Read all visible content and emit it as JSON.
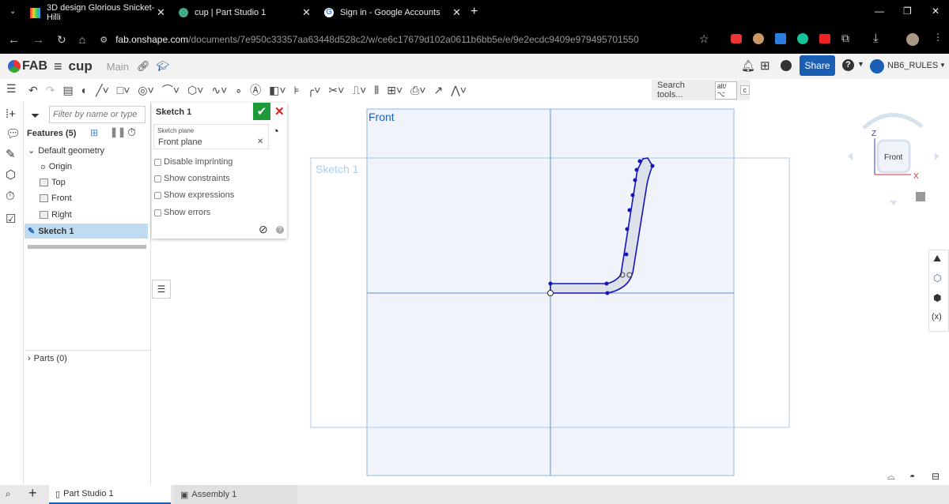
{
  "browser": {
    "tabs": [
      {
        "title": "3D design Glorious Snicket-Hilli"
      },
      {
        "title": "cup | Part Studio 1"
      },
      {
        "title": "Sign in - Google Accounts"
      }
    ],
    "url_domain": "fab.onshape.com",
    "url_path": "/documents/7e950c33357aa63448d528c2/w/ce6c17679d102a0611b6bb5e/e/9e2ecdc9409e979495701550"
  },
  "app": {
    "logo": "FAB",
    "doc_name": "cup",
    "branch": "Main",
    "share_label": "Share",
    "user": "NB6_RULES"
  },
  "toolbar": {
    "search_label": "Search tools...",
    "shortcut1": "alt/⌥",
    "shortcut2": "c"
  },
  "features": {
    "filter_placeholder": "Filter by name or type",
    "title": "Features (5)",
    "default_geometry": "Default geometry",
    "items": [
      "Origin",
      "Top",
      "Front",
      "Right"
    ],
    "sketch": "Sketch 1",
    "parts": "Parts (0)"
  },
  "dialog": {
    "title": "Sketch 1",
    "plane_label": "Sketch plane",
    "plane_value": "Front plane",
    "options": [
      "Disable imprinting",
      "Show constraints",
      "Show expressions",
      "Show errors"
    ]
  },
  "viewport": {
    "front_label": "Front",
    "sketch_label": "Sketch 1",
    "cube_face": "Front",
    "axis_z": "Z",
    "axis_x": "X"
  },
  "bottom_tabs": [
    "Part Studio 1",
    "Assembly 1"
  ],
  "colors": {
    "accent": "#1a5fb4",
    "sketch": "#1414b8",
    "confirm": "#1e9a3a",
    "cancel": "#d02020"
  }
}
